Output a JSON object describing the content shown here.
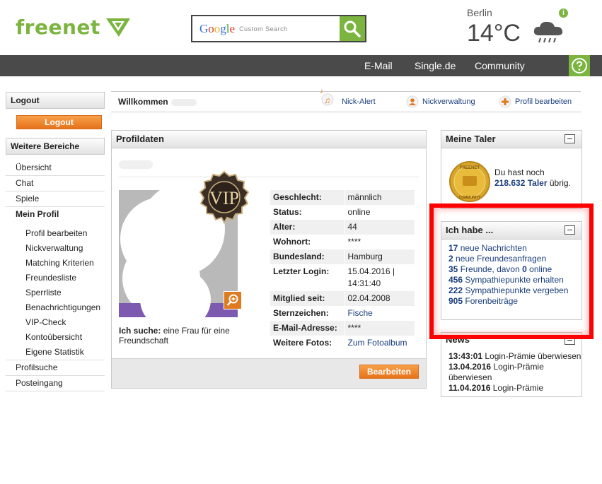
{
  "header": {
    "logo": "freenet",
    "search_brand": "Google",
    "search_placeholder": "Custom Search",
    "weather_city": "Berlin",
    "weather_temp": "14°C",
    "weather_info": "i"
  },
  "nav": {
    "items": [
      "E-Mail",
      "Single.de",
      "Community"
    ]
  },
  "left": {
    "logout_head": "Logout",
    "logout_button": "Logout",
    "more_head": "Weitere Bereiche",
    "items_top": [
      "Übersicht",
      "Chat",
      "Spiele",
      "Mein Profil"
    ],
    "items_sub": [
      "Profil bearbeiten",
      "Nickverwaltung",
      "Matching Kriterien",
      "Freundesliste",
      "Sperrliste",
      "Benachrichtigungen",
      "VIP-Check",
      "Kontoübersicht",
      "Eigene Statistik"
    ],
    "items_bottom": [
      "Profilsuche",
      "Posteingang"
    ]
  },
  "welcome": {
    "text": "Willkommen",
    "links": [
      "Nick-Alert",
      "Nickverwaltung",
      "Profil bearbeiten"
    ]
  },
  "profile": {
    "title": "Profildaten",
    "vip_label": "VIP",
    "seek_label": "Ich suche:",
    "seek_text": "eine Frau für eine Freundschaft",
    "fields": [
      {
        "k": "Geschlecht:",
        "v": "männlich"
      },
      {
        "k": "Status:",
        "v": "online"
      },
      {
        "k": "Alter:",
        "v": "44"
      },
      {
        "k": "Wohnort:",
        "v": "****"
      },
      {
        "k": "Bundesland:",
        "v": "Hamburg"
      },
      {
        "k": "Letzter Login:",
        "v": "15.04.2016 | 14:31:40"
      },
      {
        "k": "Mitglied seit:",
        "v": "02.04.2008"
      },
      {
        "k": "Sternzeichen:",
        "v": "Fische"
      },
      {
        "k": "E-Mail-Adresse:",
        "v": "****"
      },
      {
        "k": "Weitere Fotos:",
        "v": "Zum Fotoalbum"
      }
    ],
    "edit_button": "Bearbeiten"
  },
  "taler": {
    "title": "Meine Taler",
    "text_before": "Du hast noch",
    "amount": "218.632 Taler",
    "text_after": "übrig.",
    "coin_text": "FREENET COMMUNITY"
  },
  "habe": {
    "title": "Ich habe ...",
    "items": [
      {
        "n": "17",
        "t": "neue Nachrichten"
      },
      {
        "n": "2",
        "t": "neue Freundesanfragen"
      },
      {
        "n": "35",
        "t": "Freunde, davon"
      },
      {
        "n": "456",
        "t": "Sympathiepunkte erhalten"
      },
      {
        "n": "222",
        "t": "Sympathiepunkte vergeben"
      },
      {
        "n": "905",
        "t": "Forenbeiträge"
      }
    ],
    "online_count": "0",
    "online_label": "online"
  },
  "news": {
    "title": "News",
    "items": [
      {
        "date": "13:43:01",
        "text": "Login-Prämie überwiesen"
      },
      {
        "date": "13.04.2016",
        "text": "Login-Prämie überwiesen"
      },
      {
        "date": "11.04.2016",
        "text": "Login-Prämie"
      }
    ]
  }
}
